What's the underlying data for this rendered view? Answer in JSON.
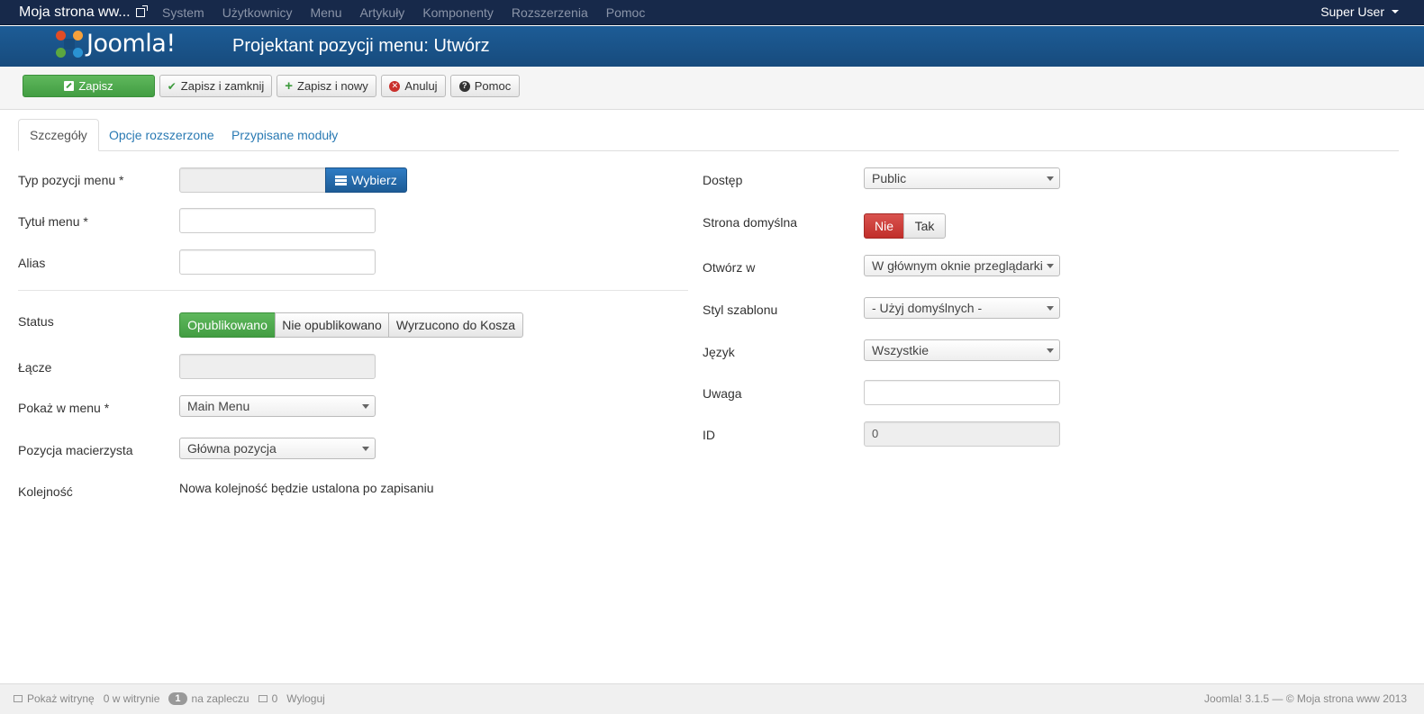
{
  "navbar": {
    "site_name": "Moja strona ww...",
    "menu": [
      "System",
      "Użytkownicy",
      "Menu",
      "Artykuły",
      "Komponenty",
      "Rozszerzenia",
      "Pomoc"
    ],
    "user": "Super User"
  },
  "header": {
    "logo_text": "Joomla!",
    "title": "Projektant pozycji menu: Utwórz"
  },
  "toolbar": {
    "save": "Zapisz",
    "save_close": "Zapisz i zamknij",
    "save_new": "Zapisz i nowy",
    "cancel": "Anuluj",
    "help": "Pomoc"
  },
  "tabs": [
    "Szczegóły",
    "Opcje rozszerzone",
    "Przypisane moduły"
  ],
  "left": {
    "menu_type_label": "Typ pozycji menu *",
    "menu_type_value": "",
    "select_button": "Wybierz",
    "title_label": "Tytuł menu *",
    "title_value": "",
    "alias_label": "Alias",
    "alias_value": "",
    "status_label": "Status",
    "status_options": [
      "Opublikowano",
      "Nie opublikowano",
      "Wyrzucono do Kosza"
    ],
    "link_label": "Łącze",
    "link_value": "",
    "menu_label": "Pokaż w menu *",
    "menu_value": "Main Menu",
    "parent_label": "Pozycja macierzysta",
    "parent_value": "Główna pozycja",
    "order_label": "Kolejność",
    "order_value": "Nowa kolejność będzie ustalona po zapisaniu"
  },
  "right": {
    "access_label": "Dostęp",
    "access_value": "Public",
    "home_label": "Strona domyślna",
    "home_options": [
      "Nie",
      "Tak"
    ],
    "target_label": "Otwórz w",
    "target_value": "W głównym oknie przeglądarki",
    "style_label": "Styl szablonu",
    "style_value": "- Użyj domyślnych -",
    "language_label": "Język",
    "language_value": "Wszystkie",
    "note_label": "Uwaga",
    "note_value": "",
    "id_label": "ID",
    "id_value": "0"
  },
  "footer": {
    "view_site": "Pokaż witrynę",
    "visitors": "0 w witrynie",
    "admins_count": "1",
    "admins_label": "na zapleczu",
    "messages": "0",
    "logout": "Wyloguj",
    "version": "Joomla! 3.1.5  —  © Moja strona www 2013"
  }
}
